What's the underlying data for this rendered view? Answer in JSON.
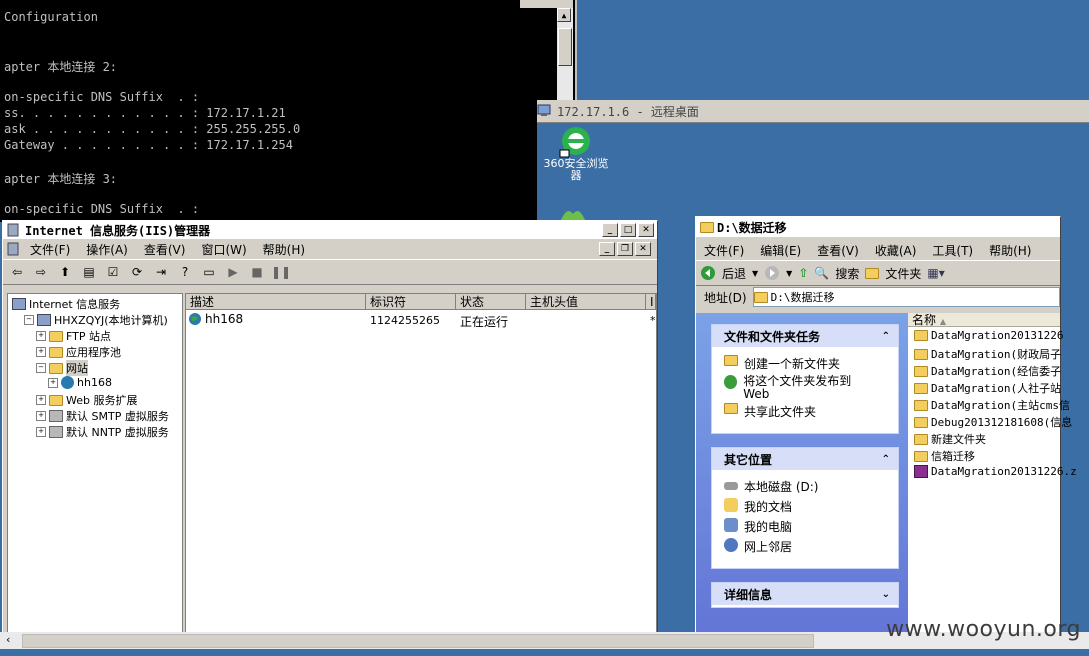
{
  "console": {
    "lines": [
      "Configuration",
      "",
      "",
      "apter 本地连接 2:",
      "",
      "on-specific DNS Suffix  . :",
      "ss. . . . . . . . . . . . : 172.17.1.21",
      "ask . . . . . . . . . . . : 255.255.255.0",
      "Gateway . . . . . . . . . : 172.17.1.254",
      "",
      "apter 本地连接 3:",
      "",
      "on-specific DNS Suffix  . :"
    ]
  },
  "rdp": {
    "title": "172.17.1.6 - 远程桌面",
    "desktop_icon": "360安全浏览器"
  },
  "iis": {
    "title": "Internet 信息服务(IIS)管理器",
    "menus": [
      "文件(F)",
      "操作(A)",
      "查看(V)",
      "窗口(W)",
      "帮助(H)"
    ],
    "tree": [
      {
        "label": "Internet 信息服务",
        "indent": 0,
        "exp": ""
      },
      {
        "label": "HHXZQYJ(本地计算机)",
        "indent": 1,
        "exp": "−"
      },
      {
        "label": "FTP 站点",
        "indent": 2,
        "exp": "+"
      },
      {
        "label": "应用程序池",
        "indent": 2,
        "exp": "+"
      },
      {
        "label": "网站",
        "indent": 2,
        "exp": "−"
      },
      {
        "label": "hh168",
        "indent": 3,
        "exp": "+"
      },
      {
        "label": "Web 服务扩展",
        "indent": 2,
        "exp": "+"
      },
      {
        "label": "默认 SMTP 虚拟服务",
        "indent": 2,
        "exp": "+"
      },
      {
        "label": "默认 NNTP 虚拟服务",
        "indent": 2,
        "exp": "+"
      }
    ],
    "columns": [
      "描述",
      "标识符",
      "状态",
      "主机头值",
      "I"
    ],
    "rows": [
      {
        "desc": "hh168",
        "id": "1124255265",
        "status": "正在运行",
        "host": "",
        "ip": "*"
      }
    ]
  },
  "explorer": {
    "title": "D:\\数据迁移",
    "menus": [
      "文件(F)",
      "编辑(E)",
      "查看(V)",
      "收藏(A)",
      "工具(T)",
      "帮助(H)"
    ],
    "toolbar": {
      "back": "后退",
      "search": "搜索",
      "folders": "文件夹"
    },
    "address_label": "地址(D)",
    "address": "D:\\数据迁移",
    "tasks": {
      "header": "文件和文件夹任务",
      "items": [
        "创建一个新文件夹",
        "将这个文件夹发布到 Web",
        "共享此文件夹"
      ]
    },
    "places": {
      "header": "其它位置",
      "items": [
        "本地磁盘 (D:)",
        "我的文档",
        "我的电脑",
        "网上邻居"
      ]
    },
    "details": {
      "header": "详细信息"
    },
    "name_col": "名称",
    "files": [
      "DataMgration20131226",
      "DataMgration(财政局子",
      "DataMgration(经信委子",
      "DataMgration(人社子站",
      "DataMgration(主站cms信",
      "Debug201312181608(信息",
      "新建文件夹",
      "信箱迁移",
      "DataMgration20131226.z"
    ]
  },
  "watermark": "www.wooyun.org",
  "colors": {
    "desktop": "#3a6ea5",
    "chrome": "#d4d0c8",
    "panel_header": "#d6dff7"
  }
}
